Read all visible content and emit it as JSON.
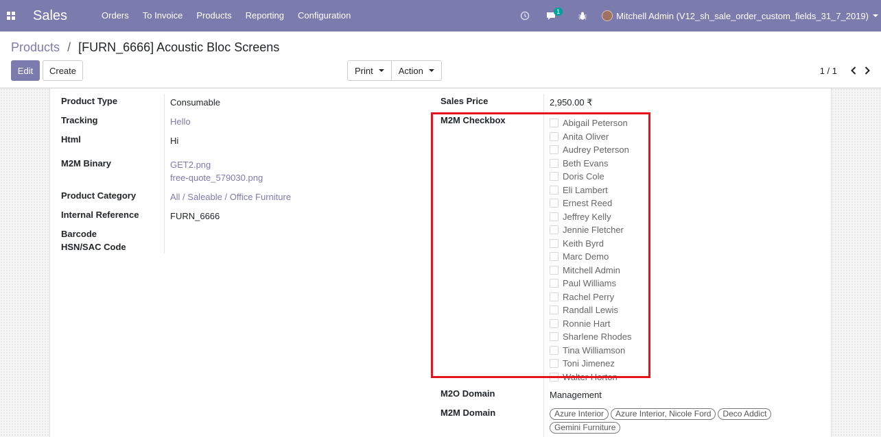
{
  "navbar": {
    "app_name": "Sales",
    "menu": [
      "Orders",
      "To Invoice",
      "Products",
      "Reporting",
      "Configuration"
    ],
    "chat_badge": "1",
    "user": "Mitchell Admin (V12_sh_sale_order_custom_fields_31_7_2019)",
    "icons": [
      "apps-grid-icon",
      "clock-icon",
      "chat-icon",
      "bug-icon",
      "avatar"
    ]
  },
  "breadcrumb": {
    "parent": "Products",
    "separator": "/",
    "current": "[FURN_6666] Acoustic Bloc Screens"
  },
  "buttons": {
    "edit": "Edit",
    "create": "Create",
    "print": "Print",
    "action": "Action"
  },
  "pager": {
    "value": "1 / 1"
  },
  "form": {
    "left": {
      "product_type": {
        "label": "Product Type",
        "value": "Consumable"
      },
      "tracking": {
        "label": "Tracking",
        "value": "Hello"
      },
      "html": {
        "label": "Html",
        "value": "Hi"
      },
      "m2m_binary": {
        "label": "M2M Binary",
        "files": [
          "GET2.png",
          "free-quote_579030.png"
        ]
      },
      "product_category": {
        "label": "Product Category",
        "value": "All / Saleable / Office Furniture"
      },
      "internal_reference": {
        "label": "Internal Reference",
        "value": "FURN_6666"
      },
      "barcode": {
        "label": "Barcode"
      },
      "hsn_sac": {
        "label": "HSN/SAC Code"
      }
    },
    "right": {
      "sales_price": {
        "label": "Sales Price",
        "value": "2,950.00 ₹"
      },
      "m2m_checkbox": {
        "label": "M2M Checkbox",
        "options": [
          "Abigail Peterson",
          "Anita Oliver",
          "Audrey Peterson",
          "Beth Evans",
          "Doris Cole",
          "Eli Lambert",
          "Ernest Reed",
          "Jeffrey Kelly",
          "Jennie Fletcher",
          "Keith Byrd",
          "Marc Demo",
          "Mitchell Admin",
          "Paul Williams",
          "Rachel Perry",
          "Randall Lewis",
          "Ronnie Hart",
          "Sharlene Rhodes",
          "Tina Williamson",
          "Toni Jimenez",
          "Walter Horton"
        ]
      },
      "m2o_domain": {
        "label": "M2O Domain",
        "value": "Management"
      },
      "m2m_domain": {
        "label": "M2M Domain",
        "tags": [
          "Azure Interior",
          "Azure Interior, Nicole Ford",
          "Deco Addict",
          "Gemini Furniture"
        ]
      }
    }
  },
  "colors": {
    "primary": "#7c7bad",
    "highlight": "#e8121d"
  }
}
